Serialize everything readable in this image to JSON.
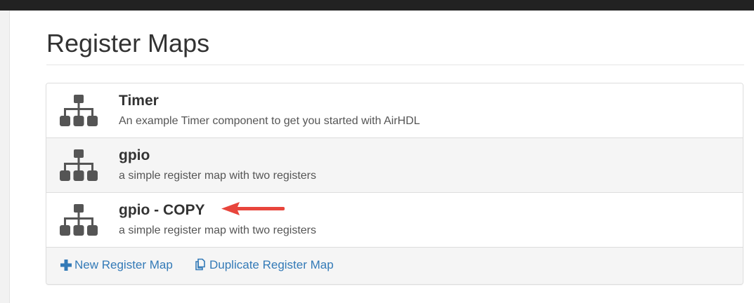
{
  "page": {
    "title": "Register Maps"
  },
  "maps": [
    {
      "name": "Timer",
      "description": "An example Timer component to get you started with AirHDL"
    },
    {
      "name": "gpio",
      "description": "a simple register map with two registers"
    },
    {
      "name": "gpio - COPY",
      "description": "a simple register map with two registers"
    }
  ],
  "footer": {
    "new_label": "New Register Map",
    "duplicate_label": "Duplicate Register Map"
  },
  "icons": {
    "map": "sitemap-icon",
    "new": "plus-icon",
    "duplicate": "copy-icon",
    "annotation": "red-arrow-icon"
  },
  "colors": {
    "link": "#337ab7",
    "icon": "#555555",
    "arrow": "#e8453c",
    "topbar": "#222222"
  }
}
